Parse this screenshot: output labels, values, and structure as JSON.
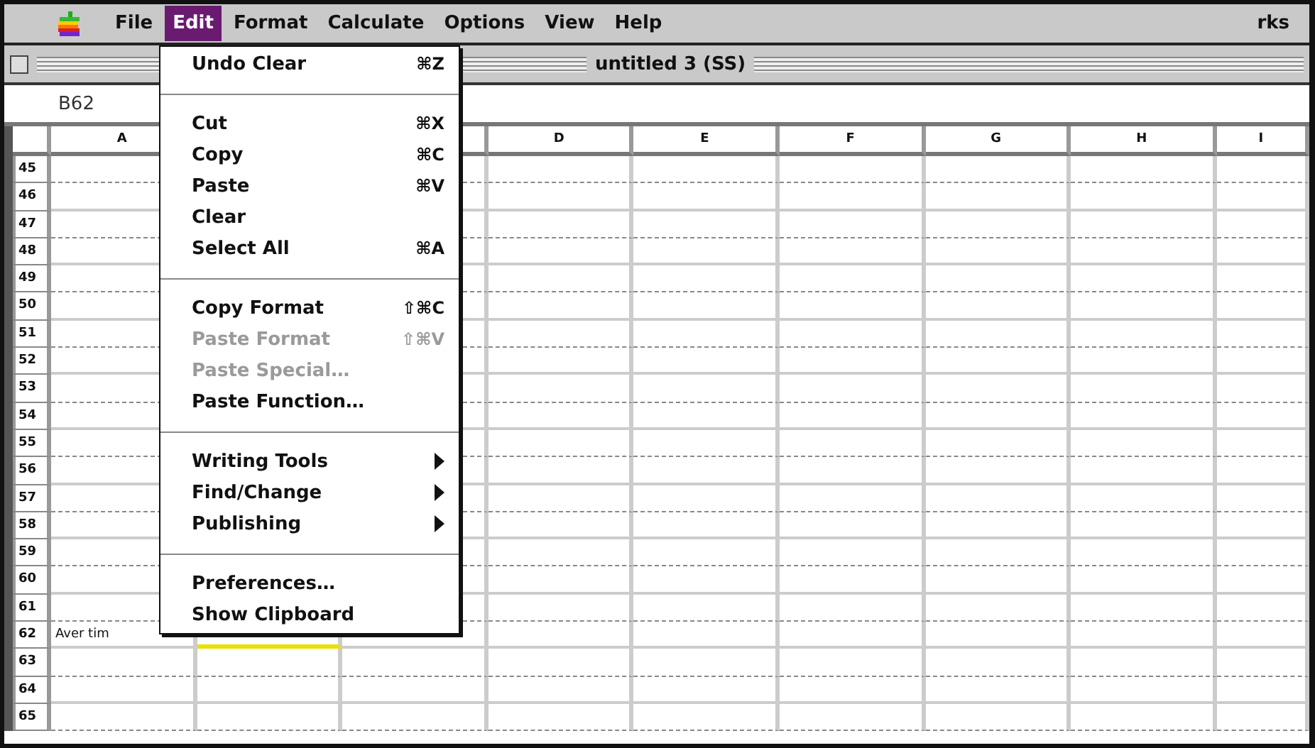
{
  "menu_bar": {
    "menus": [
      {
        "label": "File",
        "selected": false
      },
      {
        "label": "Edit",
        "selected": true
      },
      {
        "label": "Format",
        "selected": false
      },
      {
        "label": "Calculate",
        "selected": false
      },
      {
        "label": "Options",
        "selected": false
      },
      {
        "label": "View",
        "selected": false
      },
      {
        "label": "Help",
        "selected": false
      }
    ],
    "user": "rks"
  },
  "window": {
    "title": "untitled 3 (SS)"
  },
  "formula_bar": {
    "cell_reference": "B62"
  },
  "sheet": {
    "columns": [
      "A",
      null,
      null,
      "D",
      "E",
      "F",
      "G",
      "H",
      "I"
    ],
    "rows": [
      {
        "number": "45"
      },
      {
        "number": "46"
      },
      {
        "number": "47"
      },
      {
        "number": "48"
      },
      {
        "number": "49"
      },
      {
        "number": "50"
      },
      {
        "number": "51"
      },
      {
        "number": "52"
      },
      {
        "number": "53"
      },
      {
        "number": "54"
      },
      {
        "number": "55"
      },
      {
        "number": "56"
      },
      {
        "number": "57"
      },
      {
        "number": "58"
      },
      {
        "number": "59"
      },
      {
        "number": "60"
      },
      {
        "number": "61"
      },
      {
        "number": "62",
        "cells": [
          {
            "text": "Aver tim",
            "selected": false
          },
          {
            "selected": true
          }
        ]
      },
      {
        "number": "63"
      },
      {
        "number": "64"
      },
      {
        "number": "65"
      }
    ]
  },
  "edit_menu": {
    "items": [
      {
        "kind": "item",
        "label": "Undo Clear",
        "shortcut": "⌘Z",
        "disabled": false
      },
      {
        "kind": "separator"
      },
      {
        "kind": "item",
        "label": "Cut",
        "shortcut": "⌘X",
        "disabled": false
      },
      {
        "kind": "item",
        "label": "Copy",
        "shortcut": "⌘C",
        "disabled": false
      },
      {
        "kind": "item",
        "label": "Paste",
        "shortcut": "⌘V",
        "disabled": false
      },
      {
        "kind": "item",
        "label": "Clear",
        "disabled": false
      },
      {
        "kind": "item",
        "label": "Select All",
        "shortcut": "⌘A",
        "disabled": false
      },
      {
        "kind": "separator"
      },
      {
        "kind": "item",
        "label": "Copy Format",
        "shortcut": "⇧⌘C",
        "disabled": false
      },
      {
        "kind": "item",
        "label": "Paste Format",
        "shortcut": "⇧⌘V",
        "disabled": true
      },
      {
        "kind": "item",
        "label": "Paste Special…",
        "disabled": true
      },
      {
        "kind": "item",
        "label": "Paste Function…",
        "disabled": false
      },
      {
        "kind": "separator"
      },
      {
        "kind": "submenu",
        "label": "Writing Tools",
        "disabled": false
      },
      {
        "kind": "submenu",
        "label": "Find/Change",
        "disabled": false
      },
      {
        "kind": "submenu",
        "label": "Publishing",
        "disabled": false
      },
      {
        "kind": "separator"
      },
      {
        "kind": "item",
        "label": "Preferences…",
        "disabled": false
      },
      {
        "kind": "item",
        "label": "Show Clipboard",
        "disabled": false
      }
    ]
  }
}
